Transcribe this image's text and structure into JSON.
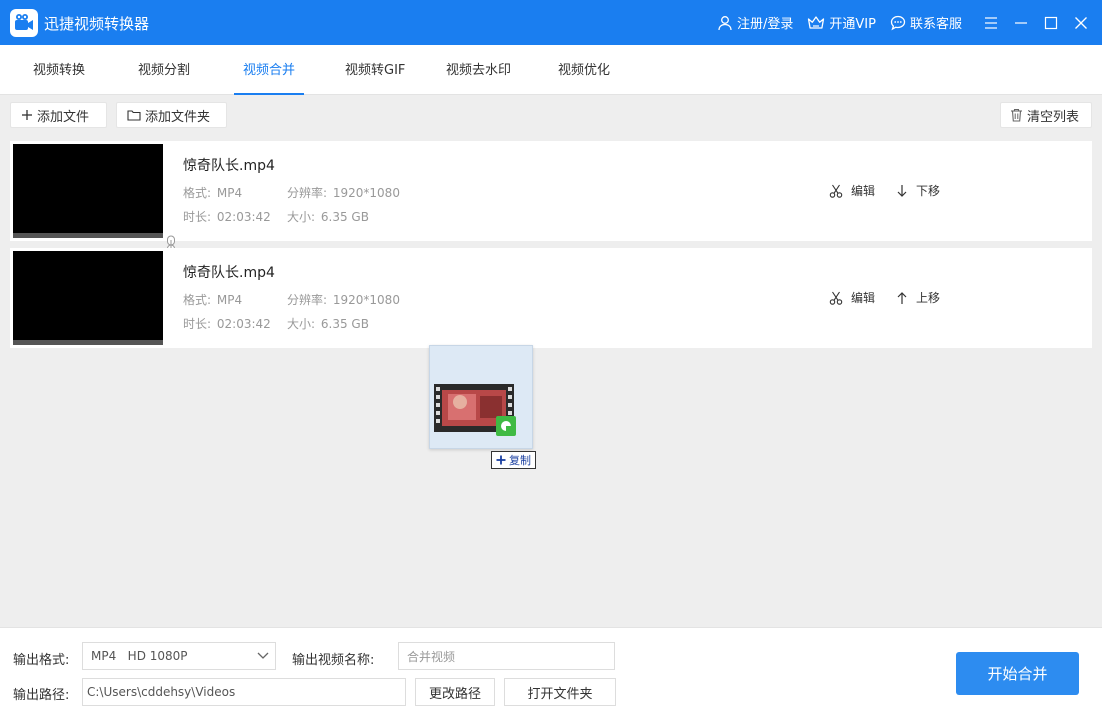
{
  "app": {
    "title": "迅捷视频转换器",
    "accent": "#1a7ef0"
  },
  "header": {
    "login": "注册/登录",
    "vip": "开通VIP",
    "support": "联系客服"
  },
  "tabs": [
    {
      "label": "视频转换"
    },
    {
      "label": "视频分割"
    },
    {
      "label": "视频合并",
      "active": true
    },
    {
      "label": "视频转GIF"
    },
    {
      "label": "视频去水印"
    },
    {
      "label": "视频优化"
    }
  ],
  "toolbar": {
    "add_file": "添加文件",
    "add_folder": "添加文件夹",
    "clear_list": "清空列表"
  },
  "files": [
    {
      "name": "惊奇队长.mp4",
      "format_label": "格式:",
      "format": "MP4",
      "resolution_label": "分辨率:",
      "resolution": "1920*1080",
      "duration_label": "时长:",
      "duration": "02:03:42",
      "size_label": "大小:",
      "size": "6.35 GB",
      "edit": "编辑",
      "move": "下移"
    },
    {
      "name": "惊奇队长.mp4",
      "format_label": "格式:",
      "format": "MP4",
      "resolution_label": "分辨率:",
      "resolution": "1920*1080",
      "duration_label": "时长:",
      "duration": "02:03:42",
      "size_label": "大小:",
      "size": "6.35 GB",
      "edit": "编辑",
      "move": "上移"
    }
  ],
  "drag": {
    "copy_label": "复制"
  },
  "bottom": {
    "format_label": "输出格式:",
    "format_value": "MP4   HD 1080P",
    "name_label": "输出视频名称:",
    "name_value": "合并视频",
    "path_label": "输出路径:",
    "path_value": "C:\\Users\\cddehsy\\Videos",
    "change_path": "更改路径",
    "open_folder": "打开文件夹",
    "start": "开始合并"
  }
}
